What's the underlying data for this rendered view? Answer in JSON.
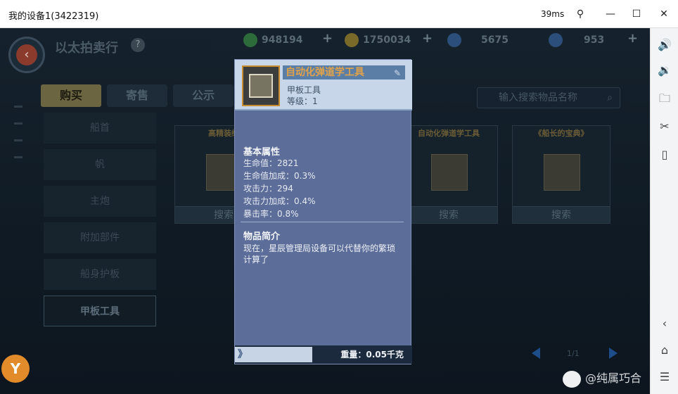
{
  "window": {
    "title": "我的设备1(3422319)",
    "ping": "39ms"
  },
  "header": {
    "title": "以太拍卖行",
    "help": "?"
  },
  "resources": [
    {
      "value": "948194",
      "color": "#2e6b3a",
      "icon": "green-coin-icon"
    },
    {
      "value": "1750034",
      "color": "#7a6a2a",
      "icon": "gold-coin-icon"
    },
    {
      "value": "5675",
      "color": "#2b4e7a",
      "icon": "blue-gem-icon"
    },
    {
      "value": "953",
      "color": "#2b4e7a",
      "icon": "blue-card-icon"
    }
  ],
  "tabs": [
    "购买",
    "寄售",
    "公示"
  ],
  "search": {
    "placeholder": "输入搜索物品名称"
  },
  "categories": [
    "船首",
    "帆",
    "主炮",
    "附加部件",
    "船身护板",
    "甲板工具"
  ],
  "cards": [
    {
      "name": "高精装给"
    },
    {
      "name": "自动化弹道学工具"
    },
    {
      "name": "《船长的宝典》"
    }
  ],
  "card_button": "搜索",
  "pager": "1/1",
  "popup": {
    "name": "自动化弹道学工具",
    "type": "甲板工具",
    "level": "等级：1",
    "basic_title": "基本属性",
    "attrs": [
      "生命值：2821",
      "生命值加成：0.3%",
      "攻击力：294",
      "攻击力加成：0.4%",
      "暴击率：0.8%"
    ],
    "intro_title": "物品简介",
    "intro_text": "现在，星辰管理局设备可以代替你的繁琐计算了",
    "weight": "重量：0.05千克",
    "chevron": "》"
  },
  "watermark": "@纯属巧合"
}
